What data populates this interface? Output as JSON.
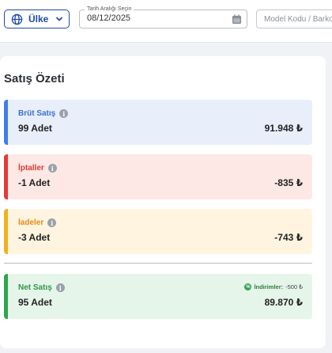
{
  "header": {
    "country_label": "Ülke",
    "date_range_legend": "Tarih Aralığı Seçin",
    "date_range_value": "08/12/2025",
    "model_placeholder": "Model Kodu / Barkod"
  },
  "summary": {
    "title": "Satış Özeti",
    "gross": {
      "label": "Brüt Satış",
      "count": "99 Adet",
      "amount": "91.948 ₺"
    },
    "cancellations": {
      "label": "İptaller",
      "count": "-1 Adet",
      "amount": "-835 ₺"
    },
    "returns": {
      "label": "İadeler",
      "count": "-3 Adet",
      "amount": "-743 ₺"
    },
    "net": {
      "label": "Net Satış",
      "count": "95 Adet",
      "amount": "89.870 ₺",
      "discount_label": "İndirimler:",
      "discount_value": "-500 ₺"
    }
  },
  "colors": {
    "brand_blue": "#1f4aa8",
    "gross_accent": "#3f7ee8",
    "cancel_accent": "#e53935",
    "return_accent": "#f2b01e",
    "net_accent": "#2fa54c"
  },
  "icons": [
    "globe-icon",
    "chevron-down-icon",
    "calendar-icon",
    "info-icon",
    "discount-badge-icon"
  ]
}
